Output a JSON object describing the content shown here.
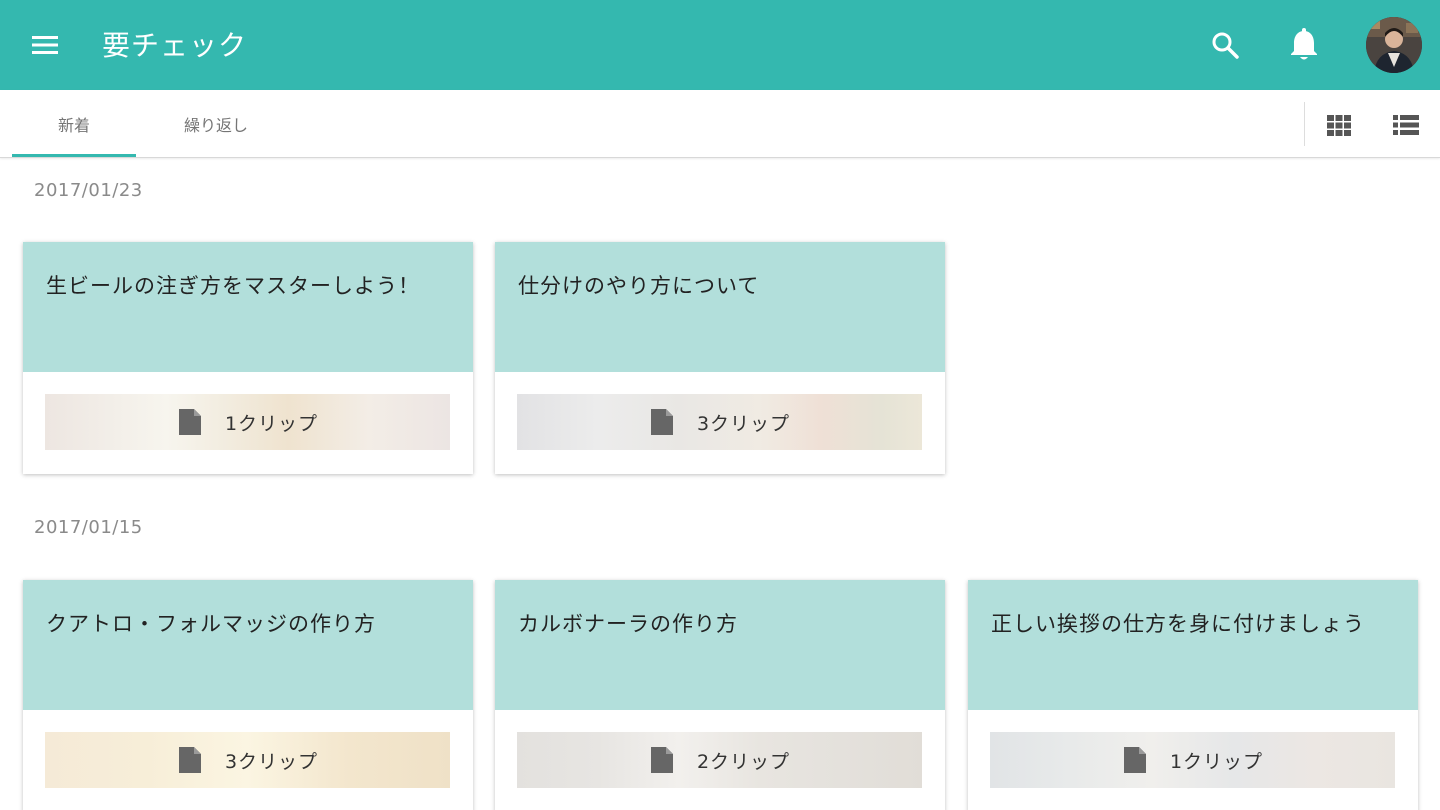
{
  "header": {
    "title": "要チェック",
    "menu_icon": "menu-icon",
    "search_icon": "search-icon",
    "notification_icon": "bell-icon",
    "accent_color": "#34b8af"
  },
  "tabs": [
    {
      "label": "新着",
      "selected": true
    },
    {
      "label": "繰り返し",
      "selected": false
    }
  ],
  "view_toggle": {
    "grid_icon": "grid-view-icon",
    "list_icon": "list-view-icon"
  },
  "sections": [
    {
      "date": "2017/01/23",
      "cards": [
        {
          "title": "生ビールの注ぎ方をマスターしよう！",
          "clips": "1クリップ"
        },
        {
          "title": "仕分けのやり方について",
          "clips": "3クリップ"
        }
      ]
    },
    {
      "date": "2017/01/15",
      "cards": [
        {
          "title": "クアトロ・フォルマッジの作り方",
          "clips": "3クリップ"
        },
        {
          "title": "カルボナーラの作り方",
          "clips": "2クリップ"
        },
        {
          "title": "正しい挨拶の仕方を身に付けましょう",
          "clips": "1クリップ"
        }
      ]
    }
  ],
  "colors": {
    "card_header": "#b2dfdb",
    "date_text": "#8a8a8a"
  }
}
